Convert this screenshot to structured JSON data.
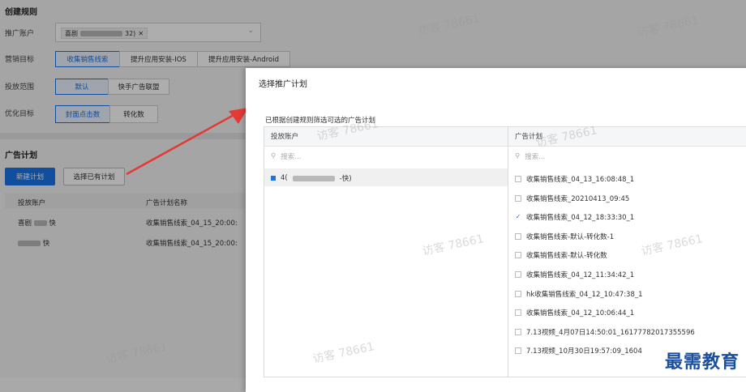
{
  "create_rule": {
    "title": "创建规则",
    "account_label": "推广账户",
    "account_tag_prefix": "喜剧",
    "account_tag_suffix": "32)",
    "goal_label": "营销目标",
    "goals": [
      "收集销售线索",
      "提升应用安装-IOS",
      "提升应用安装-Android"
    ],
    "placement_label": "投放范围",
    "placements": [
      "默认",
      "快手广告联盟"
    ],
    "optimize_label": "优化目标",
    "optimize": [
      "封面点击数",
      "转化数"
    ]
  },
  "ad_plan": {
    "title": "广告计划",
    "new_button": "新建计划",
    "select_button": "选择已有计划",
    "columns": [
      "投放账户",
      "广告计划名称"
    ],
    "rows": [
      {
        "account_prefix": "喜剧",
        "account_suffix": "快",
        "name": "收集销售线索_04_15_20:00:"
      },
      {
        "account_prefix": "",
        "account_suffix": "快",
        "name": "收集销售线索_04_15_20:00:"
      }
    ]
  },
  "modal": {
    "title": "选择推广计划",
    "subtitle": "已根据创建规则筛选可选的广告计划",
    "left_header": "投放账户",
    "left_search": "搜索...",
    "left_item_prefix": "4(",
    "left_item_suffix": "-快)",
    "right_header": "广告计划",
    "right_search": "搜索...",
    "plans": [
      {
        "label": "收集销售线索_04_13_16:08:48_1",
        "checked": false
      },
      {
        "label": "收集销售线索_20210413_09:45",
        "checked": false
      },
      {
        "label": "收集销售线索_04_12_18:33:30_1",
        "checked": true
      },
      {
        "label": "收集销售线索-默认-转化数-1",
        "checked": false
      },
      {
        "label": "收集销售线索-默认-转化数",
        "checked": false
      },
      {
        "label": "收集销售线索_04_12_11:34:42_1",
        "checked": false
      },
      {
        "label": "hk收集销售线索_04_12_10:47:38_1",
        "checked": false
      },
      {
        "label": "收集销售线索_04_12_10:06:44_1",
        "checked": false
      },
      {
        "label": "7.13视频_4月07日14:50:01_16177782017355596",
        "checked": false
      },
      {
        "label": "7.13视频_10月30日19:57:09_1604",
        "checked": false
      }
    ]
  },
  "watermarks": [
    "访客 78661",
    "访客 78661",
    "访客 78661",
    "访客 78661",
    "访客 78661",
    "访客 78661",
    "访客 78661",
    "访客 78661"
  ],
  "brand": "最需教育",
  "colors": {
    "accent": "#1a73e8",
    "arrow": "#e53935"
  }
}
